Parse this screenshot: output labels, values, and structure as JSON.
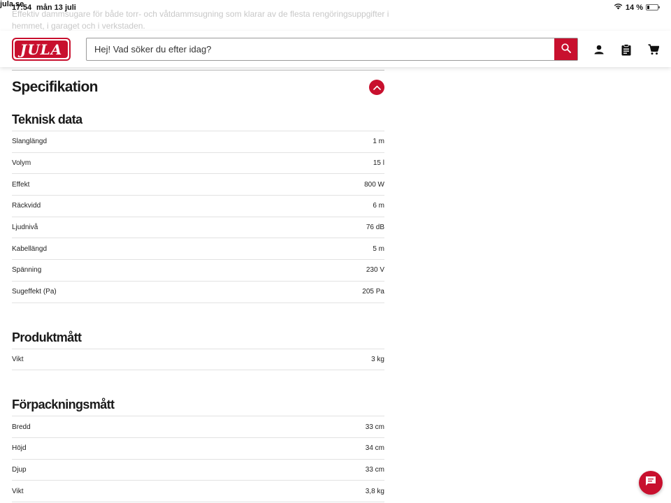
{
  "statusbar": {
    "time": "17:54",
    "date": "mån 13 juli",
    "domain": "jula.se",
    "battery": "14 %"
  },
  "background_text": "Effektiv dammsugare för både torr- och våtdammsugning som klarar av de flesta rengöringsuppgifter i hemmet, i garaget och i verkstaden.",
  "header": {
    "logo_text": "JULA",
    "search_placeholder": "Hej! Vad söker du efter idag?",
    "brand_color": "#c8102e",
    "icons": [
      "search-icon",
      "user-icon",
      "clipboard-icon",
      "cart-icon"
    ]
  },
  "specification": {
    "title": "Specifikation",
    "sections": [
      {
        "title": "Teknisk data",
        "rows": [
          {
            "label": "Slanglängd",
            "value": "1 m"
          },
          {
            "label": "Volym",
            "value": "15 l"
          },
          {
            "label": "Effekt",
            "value": "800 W"
          },
          {
            "label": "Räckvidd",
            "value": "6 m"
          },
          {
            "label": "Ljudnivå",
            "value": "76 dB"
          },
          {
            "label": "Kabellängd",
            "value": "5 m"
          },
          {
            "label": "Spänning",
            "value": "230 V"
          },
          {
            "label": "Sugeffekt (Pa)",
            "value": "205 Pa"
          }
        ]
      },
      {
        "title": "Produktmått",
        "rows": [
          {
            "label": "Vikt",
            "value": "3 kg"
          }
        ]
      },
      {
        "title": "Förpackningsmått",
        "rows": [
          {
            "label": "Bredd",
            "value": "33 cm"
          },
          {
            "label": "Höjd",
            "value": "34 cm"
          },
          {
            "label": "Djup",
            "value": "33 cm"
          },
          {
            "label": "Vikt",
            "value": "3,8 kg"
          }
        ]
      }
    ]
  }
}
